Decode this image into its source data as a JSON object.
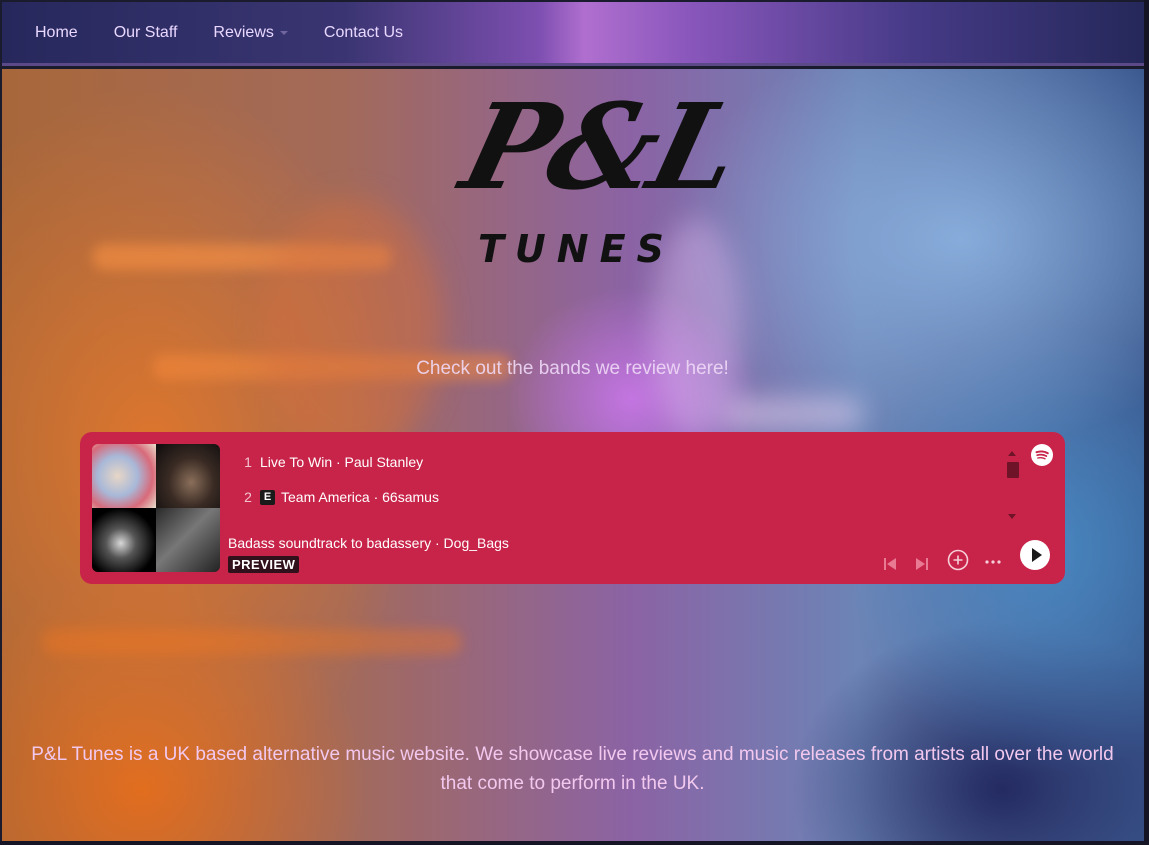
{
  "nav": {
    "items": [
      {
        "label": "Home"
      },
      {
        "label": "Our Staff"
      },
      {
        "label": "Reviews",
        "has_dropdown": true
      },
      {
        "label": "Contact Us"
      }
    ]
  },
  "hero": {
    "logo_top": "P&L",
    "logo_bottom": "TUNES",
    "tagline": "Check out the bands we review here!"
  },
  "player": {
    "tracks": [
      {
        "number": "1",
        "title": "Live To Win · Paul Stanley",
        "explicit": false
      },
      {
        "number": "2",
        "title": "Team America · 66samus",
        "explicit": true,
        "explicit_label": "E"
      }
    ],
    "playlist_title": "Badass soundtrack to badassery · Dog_Bags",
    "preview_label": "PREVIEW",
    "background_color": "#c8244a",
    "icons": [
      "spotify-logo-icon",
      "previous-track-icon",
      "next-track-icon",
      "add-icon",
      "more-options-icon",
      "play-icon"
    ]
  },
  "about": {
    "text": "P&L Tunes is a UK based alternative music website. We showcase live reviews and music releases from artists all over the world that come to perform in the UK."
  }
}
